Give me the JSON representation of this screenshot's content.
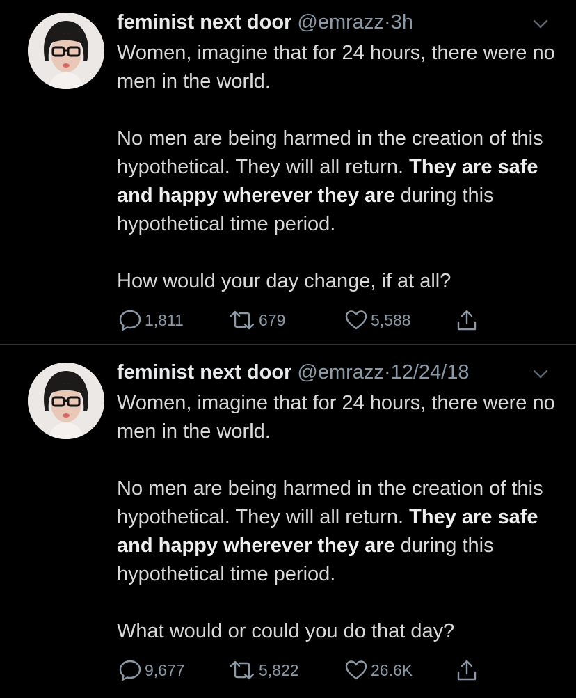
{
  "colors": {
    "background": "#000000",
    "text": "#d9d9d9",
    "muted": "#8b98a5",
    "divider": "#2f3336"
  },
  "tweets": [
    {
      "display_name": "feminist next door",
      "handle": "@emrazz",
      "separator": "·",
      "time": "3h",
      "p1": "Women, imagine that for 24 hours, there were no men in the world.",
      "p2a": "No men are being harmed in the creation of this hypothetical. They will all return. ",
      "p2b": "They are safe and happy wherever they are",
      "p2c": " during this hypothetical time period.",
      "p3": "How would your day change, if at all?",
      "replies": "1,811",
      "retweets": "679",
      "likes": "5,588",
      "icons": [
        "reply-icon",
        "retweet-icon",
        "like-icon",
        "share-icon",
        "chevron-down-icon"
      ]
    },
    {
      "display_name": "feminist next door",
      "handle": "@emrazz",
      "separator": "·",
      "time": "12/24/18",
      "p1": "Women, imagine that for 24 hours, there were no men in the world.",
      "p2a": "No men are being harmed in the creation of this hypothetical. They will all return. ",
      "p2b": "They are safe and happy wherever they are",
      "p2c": " during this hypothetical time period.",
      "p3": "What would or could you do that day?",
      "replies": "9,677",
      "retweets": "5,822",
      "likes": "26.6K",
      "icons": [
        "reply-icon",
        "retweet-icon",
        "like-icon",
        "share-icon",
        "chevron-down-icon"
      ]
    }
  ]
}
